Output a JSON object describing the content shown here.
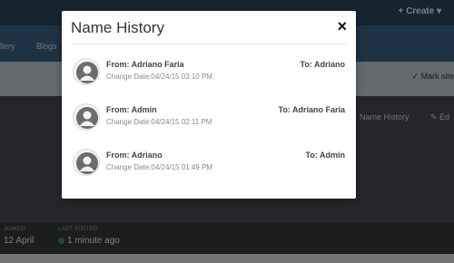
{
  "background": {
    "create_label": "+ Create ▾",
    "nav": [
      "llery",
      "Blogs"
    ],
    "mark_label": "✓ Mark site",
    "tabs": [
      "Name History",
      "✎ Ed"
    ],
    "stats": {
      "joined_label": "JOINED",
      "joined_value": "12 April",
      "last_visited_label": "LAST VISITED",
      "last_visited_value": "1 minute ago"
    }
  },
  "modal": {
    "title": "Name History",
    "close_label": "×",
    "entries": [
      {
        "from": "From: Adriano Faria",
        "to": "To: Adriano",
        "date": "Change Date:04/24/15 03:10 PM"
      },
      {
        "from": "From: Admin",
        "to": "To: Adriano Faria",
        "date": "Change Date:04/24/15 02:11 PM"
      },
      {
        "from": "From: Adriano",
        "to": "To: Admin",
        "date": "Change Date:04/24/15 01:49 PM"
      }
    ]
  }
}
